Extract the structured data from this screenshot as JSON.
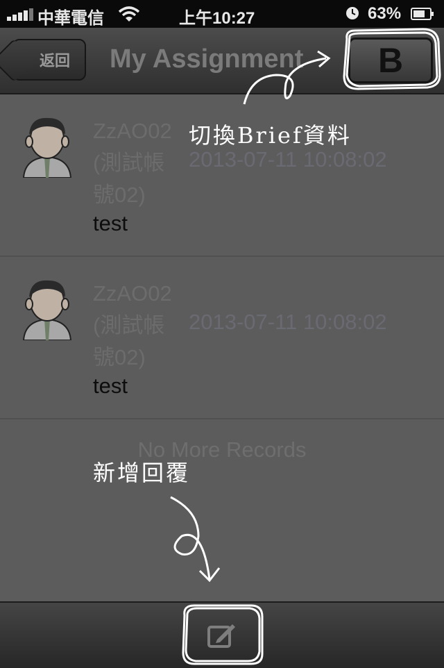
{
  "status_bar": {
    "carrier": "中華電信",
    "time": "上午10:27",
    "battery_percent": "63%",
    "icons": [
      "signal-bars-icon",
      "wifi-icon",
      "clock-icon",
      "battery-icon"
    ]
  },
  "nav": {
    "back_label": "返回",
    "title": "My Assignment",
    "brief_button_label": "B"
  },
  "messages": [
    {
      "author_line1": "ZzAO02",
      "author_line2": "(測試帳",
      "author_line3": "號02)",
      "timestamp": "2013-07-11 10:08:02",
      "content": "test"
    },
    {
      "author_line1": "ZzAO02",
      "author_line2": "(測試帳",
      "author_line3": "號02)",
      "timestamp": "2013-07-11 10:08:02",
      "content": "test"
    }
  ],
  "list_footer": "No More Records",
  "annotations": {
    "switch_brief": "切換Brief資料",
    "add_reply": "新增回覆"
  },
  "toolbar": {
    "compose_icon": "compose-icon"
  },
  "colors": {
    "overlay_bg": "#5c5c5c",
    "navbar": "#3c3c3c",
    "annotation": "#ffffff"
  }
}
